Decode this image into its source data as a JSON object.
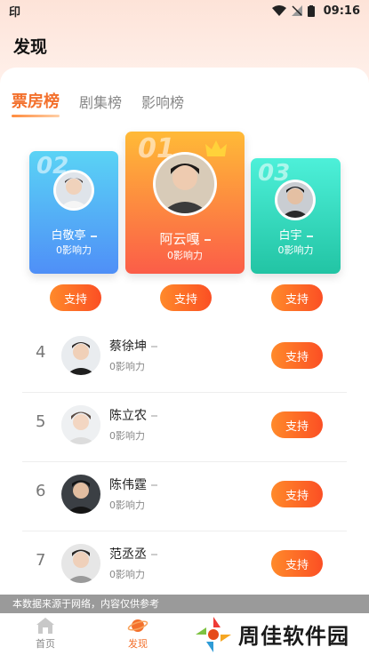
{
  "status_bar": {
    "left_icon": "印",
    "time": "09:16"
  },
  "page": {
    "title": "发现"
  },
  "tabs": [
    {
      "label": "票房榜",
      "active": true
    },
    {
      "label": "剧集榜",
      "active": false
    },
    {
      "label": "影响榜",
      "active": false
    }
  ],
  "podium": [
    {
      "rank": "02",
      "name": "白敬亭",
      "power": "0影响力"
    },
    {
      "rank": "01",
      "name": "阿云嘎",
      "power": "0影响力"
    },
    {
      "rank": "03",
      "name": "白宇",
      "power": "0影响力"
    }
  ],
  "support_label": "支持",
  "list": [
    {
      "rank": "4",
      "name": "蔡徐坤",
      "power": "0影响力"
    },
    {
      "rank": "5",
      "name": "陈立农",
      "power": "0影响力"
    },
    {
      "rank": "6",
      "name": "陈伟霆",
      "power": "0影响力"
    },
    {
      "rank": "7",
      "name": "范丞丞",
      "power": "0影响力"
    }
  ],
  "notice": "本数据来源于网络，内容仅供参考",
  "bottom_nav": [
    {
      "label": "首页",
      "icon": "home-icon",
      "active": false
    },
    {
      "label": "发现",
      "icon": "planet-icon",
      "active": true
    }
  ],
  "watermark": {
    "text": "周佳软件园"
  },
  "colors": {
    "accent": "#f3702c",
    "podium_2": "#4f8ff7",
    "podium_1": "#fb5d48",
    "podium_3": "#22c4a4"
  }
}
